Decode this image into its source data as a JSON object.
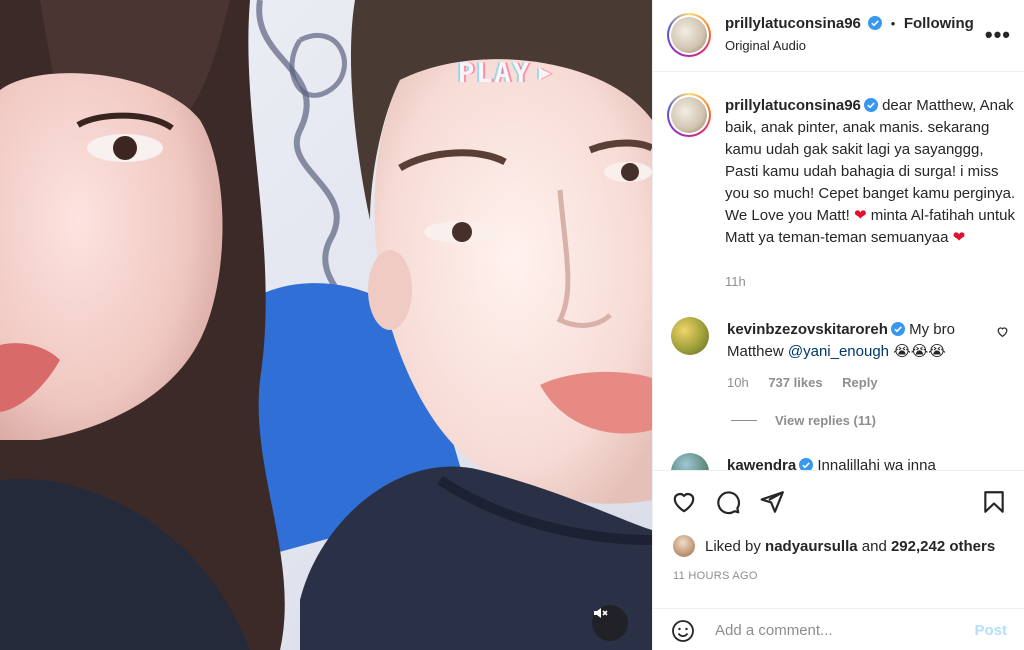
{
  "media": {
    "overlay_text": "PLAY",
    "overlay_icon": "play-triangle-icon",
    "audio_icon": "speaker-muted-icon"
  },
  "header": {
    "username": "prillylatuconsina96",
    "separator": "•",
    "follow_status": "Following",
    "subtitle": "Original Audio",
    "more_icon": "more-dots-icon"
  },
  "caption": {
    "username": "prillylatuconsina96",
    "text_before_heart1": "dear Matthew, Anak baik, anak pinter, anak manis. sekarang kamu udah gak sakit lagi ya sayanggg, Pasti kamu udah bahagia di surga! i miss you so much! Cepet banget kamu perginya. We Love you Matt!",
    "text_after_heart1": "minta Al-fatihah untuk Matt ya teman-teman semuanyaa",
    "heart": "❤",
    "time": "11h"
  },
  "comments": [
    {
      "username": "kevinbzezovskitaroreh",
      "text": "My bro Matthew",
      "mention": "@yani_enough",
      "emoji": "😭😭😭",
      "time": "10h",
      "likes": "737 likes",
      "reply": "Reply",
      "view_replies": "View replies (11)"
    },
    {
      "username": "kawendra",
      "text": "Innalillahi wa inna"
    }
  ],
  "actions": {
    "liked_by_prefix": "Liked by",
    "liked_by_user": "nadyaursulla",
    "and_text": "and",
    "others_count": "292,242 others",
    "time_ago": "11 HOURS AGO"
  },
  "add_comment": {
    "placeholder": "Add a comment...",
    "post_label": "Post"
  },
  "colors": {
    "verified": "#3897f0",
    "link": "#00376b",
    "muted": "#8e8e8e",
    "post_disabled": "#b2dffc"
  }
}
